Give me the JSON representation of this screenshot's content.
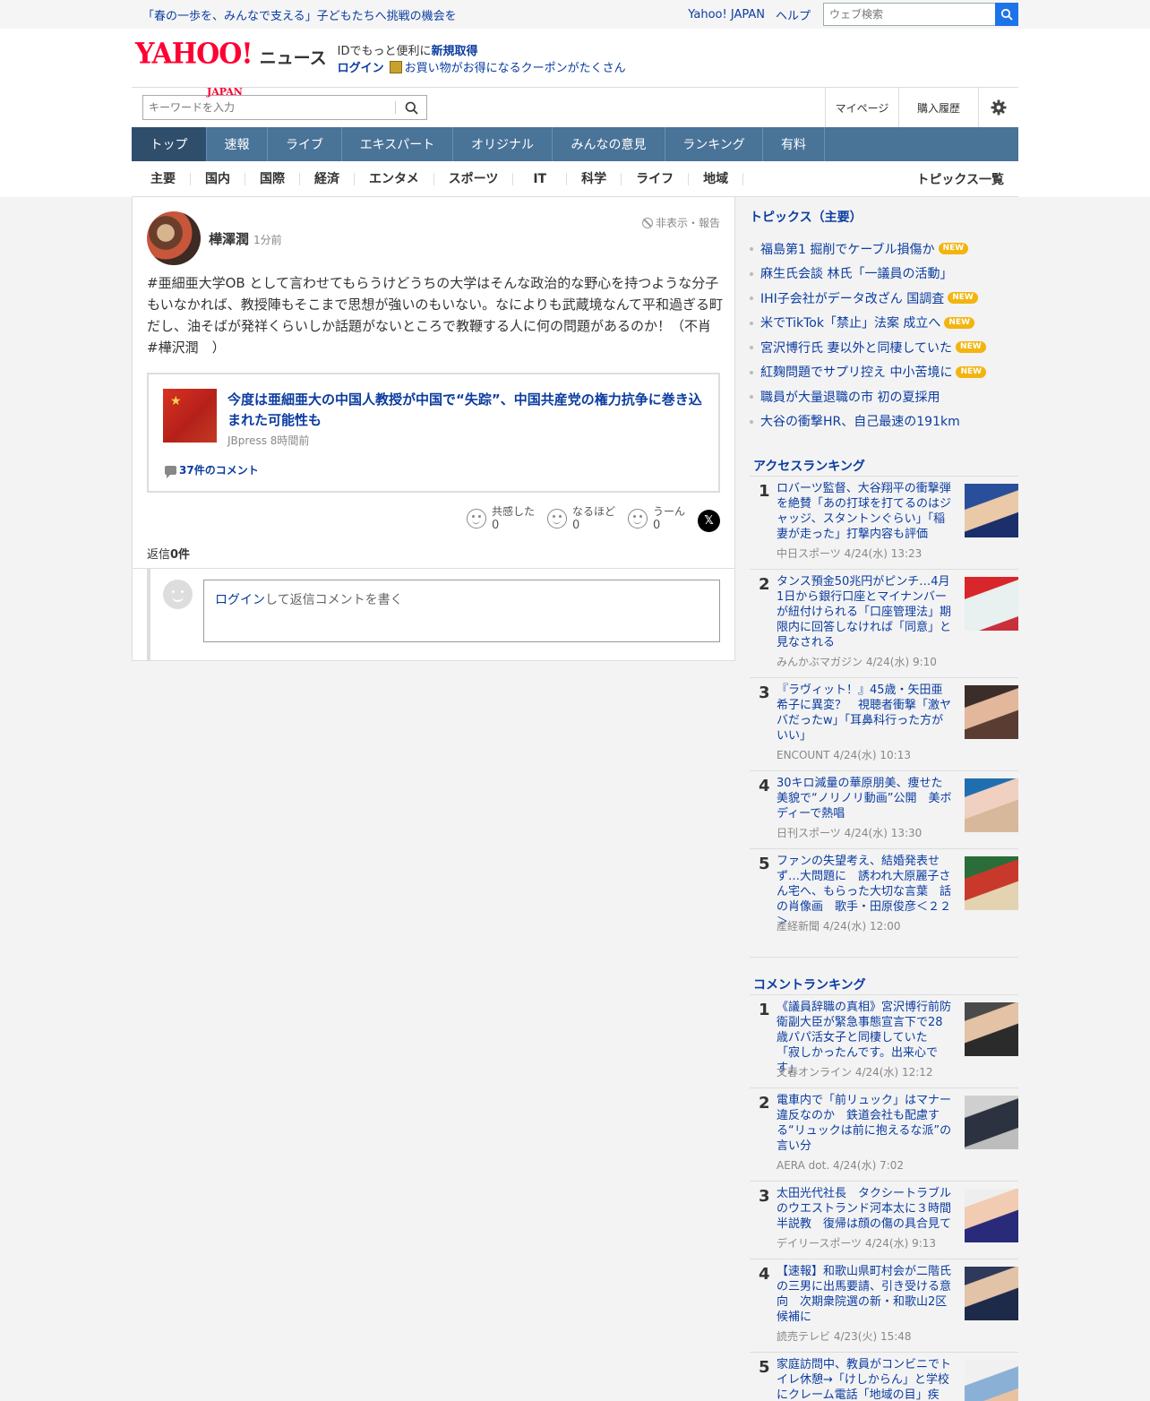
{
  "topbar": {
    "promo": "「春の一歩を、みんなで支える」子どもたちへ挑戦の機会を",
    "yahoo_japan": "Yahoo! JAPAN",
    "help": "ヘルプ",
    "web_search_placeholder": "ウェブ検索"
  },
  "masthead": {
    "logo_yahoo": "YAHOO!",
    "logo_japan": "JAPAN",
    "logo_news": "ニュース",
    "id_text": "IDでもっと便利に",
    "id_signup": "新規取得",
    "login": "ログイン",
    "coupon": "お買い物がお得になるクーポンがたくさん"
  },
  "search": {
    "placeholder": "キーワードを入力",
    "mypage": "マイページ",
    "history": "購入履歴"
  },
  "nav": [
    "トップ",
    "速報",
    "ライブ",
    "エキスパート",
    "オリジナル",
    "みんなの意見",
    "ランキング",
    "有料"
  ],
  "subnav": [
    "主要",
    "国内",
    "国際",
    "経済",
    "エンタメ",
    "スポーツ",
    "IT",
    "科学",
    "ライフ",
    "地域"
  ],
  "subnav_all": "トピックス一覧",
  "comment": {
    "author": "樺澤潤",
    "time": "1分前",
    "report": "非表示・報告",
    "text": "#亜細亜大学OB として言わせてもらうけどうちの大学はそんな政治的な野心を持つような分子もいなかれば、教授陣もそこまで思想が強いのもいない。なによりも武蔵境なんて平和過ぎる町だし、油そばが発祥くらいしか話題がないところで教鞭する人に何の問題があるのか！（不肖　#樺沢潤　）",
    "article_title": "今度は亜細亜大の中国人教授が中国で“失踪”、中国共産党の権力抗争に巻き込まれた可能性も",
    "article_source": "JBpress 8時間前",
    "article_comments": "37件のコメント",
    "reactions": [
      {
        "label": "共感した",
        "count": "0"
      },
      {
        "label": "なるほど",
        "count": "0"
      },
      {
        "label": "うーん",
        "count": "0"
      }
    ],
    "x_label": "𝕏",
    "reply_label": "返信",
    "reply_count": "0件",
    "reply_login": "ログイン",
    "reply_prompt": "して返信コメントを書く"
  },
  "topics": {
    "title": "トピックス（主要）",
    "new_label": "NEW",
    "items": [
      {
        "text": "福島第1 掘削でケーブル損傷か",
        "new": true
      },
      {
        "text": "麻生氏会談 林氏「一議員の活動」",
        "new": false
      },
      {
        "text": "IHI子会社がデータ改ざん 国調査",
        "new": true
      },
      {
        "text": "米でTikTok「禁止」法案 成立へ",
        "new": true
      },
      {
        "text": "宮沢博行氏 妻以外と同棲していた",
        "new": true
      },
      {
        "text": "紅麹問題でサプリ控え 中小苦境に",
        "new": true
      },
      {
        "text": "職員が大量退職の市 初の夏採用",
        "new": false
      },
      {
        "text": "大谷の衝撃HR、自己最速の191km",
        "new": false
      }
    ]
  },
  "access_ranking": {
    "title": "アクセスランキング",
    "items": [
      {
        "num": "1",
        "title": "ロバーツ監督、大谷翔平の衝撃弾を絶賛「あの打球を打てるのはジャッジ、スタントンぐらい」「稲妻が走った」打撃内容も評価",
        "source": "中日スポーツ 4/24(水) 13:23"
      },
      {
        "num": "2",
        "title": "タンス預金50兆円がピンチ…4月1日から銀行口座とマイナンバーが紐付けられる「口座管理法」期限内に回答しなければ「同意」と見なされる",
        "source": "みんかぶマガジン 4/24(水) 9:10"
      },
      {
        "num": "3",
        "title": "『ラヴィット！』45歳・矢田亜希子に異変？　視聴者衝撃「激ヤバだったw」「耳鼻科行った方がいい」",
        "source": "ENCOUNT 4/24(水) 10:13"
      },
      {
        "num": "4",
        "title": "30キロ減量の華原朋美、痩せた美貌で“ノリノリ動画”公開　美ボディーで熱唱",
        "source": "日刊スポーツ 4/24(水) 13:30"
      },
      {
        "num": "5",
        "title": "ファンの失望考え、結婚発表せず…大問題に　誘われ大原麗子さん宅へ、もらった大切な言葉　話の肖像画　歌手・田原俊彦＜２２＞",
        "source": "産経新聞 4/24(水) 12:00"
      }
    ]
  },
  "comment_ranking": {
    "title": "コメントランキング",
    "items": [
      {
        "num": "1",
        "title": "《議員辞職の真相》宮沢博行前防衛副大臣が緊急事態宣言下で28歳パパ活女子と同棲していた　「寂しかったんです。出来心です」",
        "source": "文春オンライン 4/24(水) 12:12"
      },
      {
        "num": "2",
        "title": "電車内で「前リュック」はマナー違反なのか　鉄道会社も配慮する“リュックは前に抱えるな派”の言い分",
        "source": "AERA dot. 4/24(水) 7:02"
      },
      {
        "num": "3",
        "title": "太田光代社長　タクシートラブルのウエストランド河本太に３時間半説教　復帰は顔の傷の具合見て",
        "source": "デイリースポーツ 4/24(水) 9:13"
      },
      {
        "num": "4",
        "title": "【速報】和歌山県町村会が二階氏の三男に出馬要請、引き受ける意向　次期衆院選の新・和歌山2区候補に",
        "source": "読売テレビ 4/23(火) 15:48"
      },
      {
        "num": "5",
        "title": "家庭訪問中、教員がコンビニでトイレ休憩→「けしからん」と学校にクレーム電話「地域の目」疾",
        "source": ""
      }
    ]
  },
  "colors": {
    "nav": "#4a7398",
    "nav_active": "#2f4e6c",
    "link": "#0b3ca0",
    "new_badge": "#f2b40f"
  }
}
